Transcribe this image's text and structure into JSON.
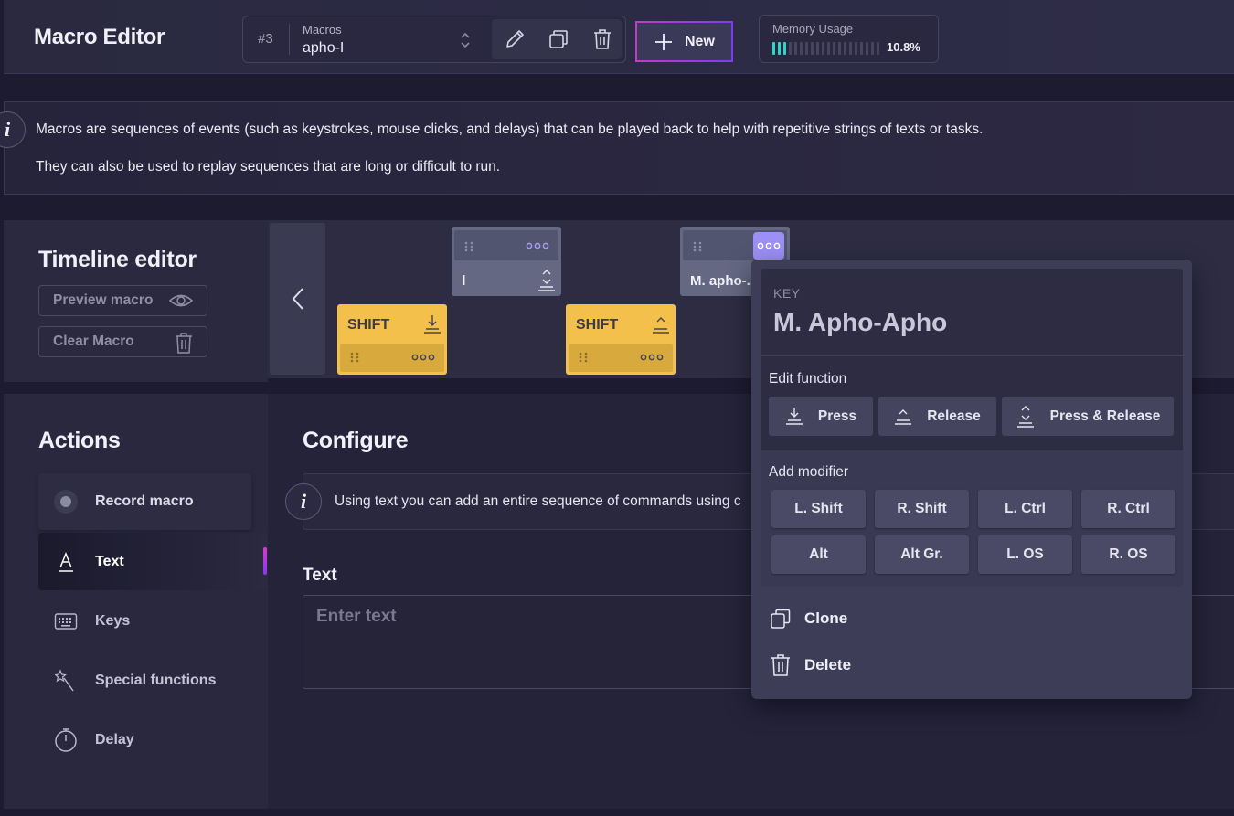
{
  "header": {
    "title": "Macro Editor",
    "macro_number": "#3",
    "macro_label": "Macros",
    "macro_value": "apho-I",
    "new_label": "New",
    "memory_label": "Memory Usage",
    "memory_value": "10.8%",
    "memory_fraction": 0.108
  },
  "info": {
    "icon": "i",
    "line1": "Macros are sequences of events (such as keystrokes, mouse clicks, and delays) that can be played back to help with repetitive strings of texts or tasks.",
    "line2": "They can also be used to replay sequences that are long or difficult to run."
  },
  "timeline": {
    "title": "Timeline editor",
    "preview_label": "Preview macro",
    "clear_label": "Clear Macro",
    "blocks": [
      {
        "label": "I",
        "kind": "key"
      },
      {
        "label": "M. apho-...",
        "kind": "key"
      },
      {
        "label": "SHIFT",
        "kind": "modifier-press"
      },
      {
        "label": "SHIFT",
        "kind": "modifier-release"
      }
    ]
  },
  "actions": {
    "title": "Actions",
    "items": [
      {
        "label": "Record macro",
        "icon": "record-icon"
      },
      {
        "label": "Text",
        "icon": "text-icon"
      },
      {
        "label": "Keys",
        "icon": "keyboard-icon"
      },
      {
        "label": "Special functions",
        "icon": "magic-wand-icon"
      },
      {
        "label": "Delay",
        "icon": "stopwatch-icon"
      }
    ]
  },
  "configure": {
    "title": "Configure",
    "info_text": "Using text you can add an entire sequence of commands using c",
    "text_label": "Text",
    "text_placeholder": "Enter text"
  },
  "popup": {
    "key_label": "KEY",
    "key_name": "M. Apho-Apho",
    "edit_function_label": "Edit function",
    "functions": [
      "Press",
      "Release",
      "Press & Release"
    ],
    "add_modifier_label": "Add modifier",
    "modifiers": [
      "L. Shift",
      "R. Shift",
      "L. Ctrl",
      "R. Ctrl",
      "Alt",
      "Alt Gr.",
      "L. OS",
      "R. OS"
    ],
    "clone_label": "Clone",
    "delete_label": "Delete"
  },
  "colors": {
    "accent_pink": "#c43ac9",
    "accent_purple": "#7e3cf2",
    "memory_on": "#2fd5c6",
    "block_yellow": "#f3c14b",
    "block_gray": "#646883",
    "selected_dots": "#9c8ff5"
  }
}
